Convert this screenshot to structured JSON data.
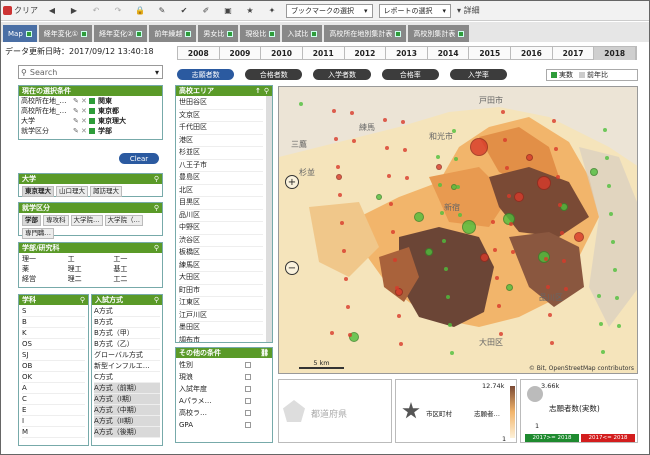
{
  "toolbar": {
    "clear_label": "クリア",
    "bookmark_select": "ブックマークの選択",
    "report_select": "レポートの選択",
    "detail_label": "詳細"
  },
  "tabs": [
    {
      "label": "Map"
    },
    {
      "label": "経年変化①"
    },
    {
      "label": "経年変化②"
    },
    {
      "label": "前年繰越"
    },
    {
      "label": "男女比"
    },
    {
      "label": "現役比"
    },
    {
      "label": "入試比"
    },
    {
      "label": "高校所在地別集計表"
    },
    {
      "label": "高校別集計表"
    }
  ],
  "last_update": "データ更新日時：2017/09/12 13:40:18",
  "years": [
    "2008",
    "2009",
    "2010",
    "2011",
    "2012",
    "2013",
    "2014",
    "2015",
    "2016",
    "2017",
    "2018"
  ],
  "selected_year": "2018",
  "metrics": [
    "志願者数",
    "合格者数",
    "入学者数",
    "合格率",
    "入学率"
  ],
  "toggle": {
    "actual": "実数",
    "yoy": "前年比"
  },
  "search": {
    "placeholder": "Search"
  },
  "current_selection": {
    "title": "現在の選択条件",
    "rows": [
      {
        "field": "高校所在地_…",
        "value": "関東"
      },
      {
        "field": "高校所在地_…",
        "value": "東京都"
      },
      {
        "field": "大学",
        "value": "東京理大"
      },
      {
        "field": "就学区分",
        "value": "学部"
      }
    ]
  },
  "clear_button": "Clear",
  "university": {
    "title": "大学",
    "items": [
      "東京理大",
      "山口理大",
      "諏訪理大"
    ]
  },
  "schooling": {
    "title": "就学区分",
    "items": [
      "学部",
      "専攻科",
      "大学院…",
      "大学院（…",
      "専門職…"
    ]
  },
  "faculty": {
    "title": "学部/研究科",
    "items": [
      "理一",
      "工",
      "工一",
      "薬",
      "理工",
      "基工",
      "経営",
      "理二",
      "工二"
    ]
  },
  "department": {
    "title": "学科",
    "items": [
      "S",
      "B",
      "K",
      "OS",
      "SJ",
      "OB",
      "OK",
      "A",
      "C",
      "E",
      "I",
      "M"
    ]
  },
  "entrance": {
    "title": "入試方式",
    "items": [
      "A方式",
      "B方式",
      "B方式（甲）",
      "B方式（乙）",
      "グローバル方式",
      "新型インフルエ…",
      "C方式",
      "A方式（前期）",
      "A方式（I期）",
      "A方式（中期）",
      "A方式（II期）",
      "A方式（後期）"
    ]
  },
  "hs_area": {
    "title": "高校エリア",
    "items": [
      "世田谷区",
      "文京区",
      "千代田区",
      "港区",
      "杉並区",
      "八王子市",
      "豊島区",
      "北区",
      "目黒区",
      "品川区",
      "中野区",
      "渋谷区",
      "板橋区",
      "練馬区",
      "大田区",
      "町田市",
      "江東区",
      "江戸川区",
      "墨田区",
      "調布市",
      "小平市"
    ]
  },
  "other_conditions": {
    "title": "その他の条件",
    "items": [
      "性別",
      "現浪",
      "入試年度",
      "Aパラメ…",
      "高校ラ…",
      "GPA"
    ]
  },
  "map": {
    "labels": [
      "三鷹",
      "杉並",
      "練馬",
      "和光市",
      "戸田市",
      "新宿",
      "品川区",
      "大田区"
    ],
    "scale": "5 km",
    "attribution": "© Bit, OpenStreetMap contributors"
  },
  "bottom": {
    "prefecture_label": "都道府県",
    "city_label": "市区町村",
    "applicants_short": "志願者…",
    "legend_max": "12.74k",
    "legend_min": "1",
    "bubble_max": "3.66k",
    "bubble_label": "志願者数(実数)",
    "bubble_min": "1",
    "year_range_up": "2017>= 2018",
    "year_range_down": "2017<= 2018"
  },
  "colors": {
    "tab_blue": "#4a6fa5",
    "green": "#5a9a28",
    "choropleth_dark": "#6b4a3a",
    "choropleth_mid": "#d9823a",
    "choropleth_light": "#f2c98a"
  }
}
